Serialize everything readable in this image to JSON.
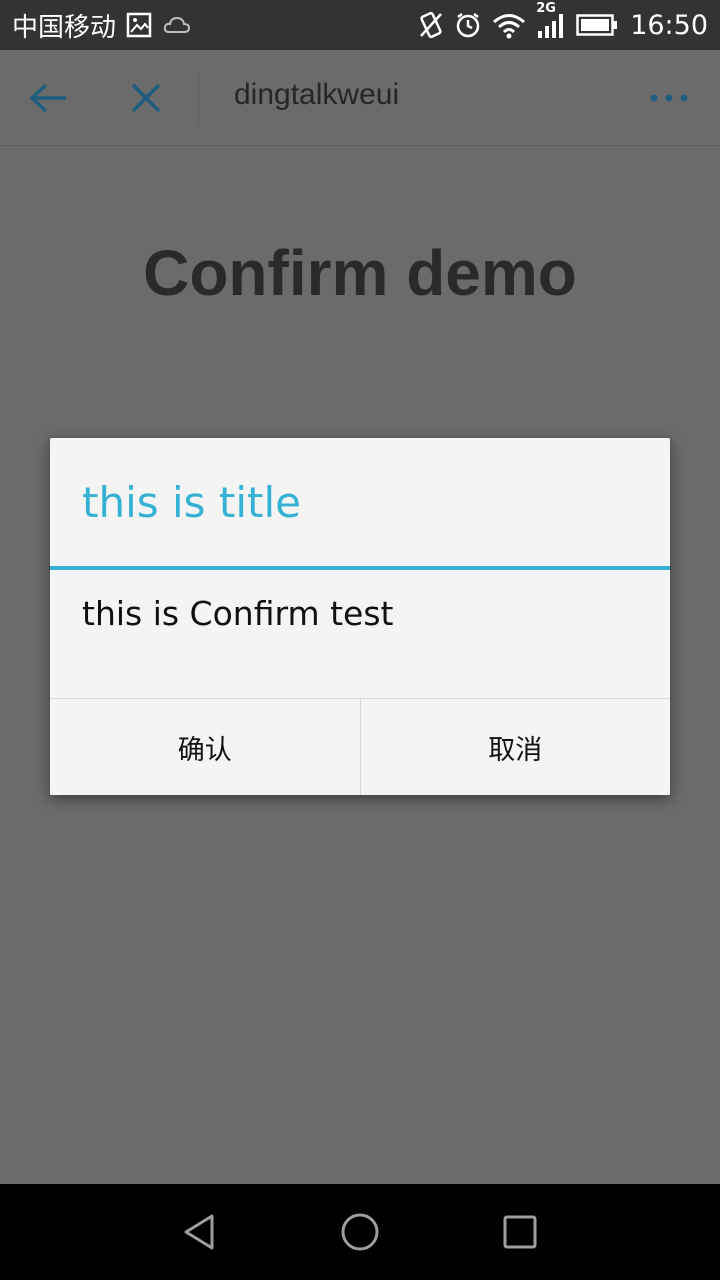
{
  "status_bar": {
    "carrier": "中国移动",
    "network_badge": "2G",
    "time": "16:50",
    "icons": [
      "photo-icon",
      "cloud-icon",
      "vibrate-icon",
      "alarm-icon",
      "wifi-icon",
      "signal-icon",
      "battery-icon"
    ]
  },
  "nav_bar": {
    "title": "dingtalkweui",
    "icons": [
      "back-arrow-icon",
      "close-icon",
      "more-icon"
    ],
    "accent_color": "#1f5d7f"
  },
  "page": {
    "heading": "Confirm demo"
  },
  "dialog": {
    "title": "this is title",
    "message": "this is Confirm test",
    "confirm_label": "确认",
    "cancel_label": "取消",
    "accent_color": "#35b2d3"
  },
  "android_nav": {
    "icons": [
      "back-triangle-icon",
      "home-circle-icon",
      "recents-square-icon"
    ]
  }
}
